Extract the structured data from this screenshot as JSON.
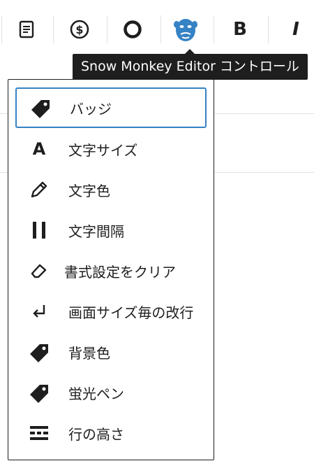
{
  "tooltip": {
    "text": "Snow Monkey Editor コントロール"
  },
  "toolbar": {
    "buttons": [
      {
        "name": "list-icon",
        "label": ""
      },
      {
        "name": "dollar-icon",
        "label": ""
      },
      {
        "name": "circle-icon",
        "label": ""
      },
      {
        "name": "monkey-icon",
        "label": "",
        "color": "#3582c4"
      },
      {
        "name": "bold-button",
        "label": "B"
      },
      {
        "name": "italic-button",
        "label": "I"
      }
    ]
  },
  "menu": {
    "items": [
      {
        "icon": "tag-icon",
        "label": "バッジ",
        "active": true
      },
      {
        "icon": "font-size-icon",
        "label": "文字サイズ",
        "glyph": "A"
      },
      {
        "icon": "pencil-icon",
        "label": "文字色"
      },
      {
        "icon": "letter-spacing-icon",
        "label": "文字間隔"
      },
      {
        "icon": "eraser-icon",
        "label": "書式設定をクリア"
      },
      {
        "icon": "return-arrow-icon",
        "label": "画面サイズ毎の改行"
      },
      {
        "icon": "tag-icon",
        "label": "背景色"
      },
      {
        "icon": "tag-icon",
        "label": "蛍光ペン"
      },
      {
        "icon": "line-height-icon",
        "label": "行の高さ"
      }
    ]
  },
  "colors": {
    "accent": "#3582c4",
    "tooltip_bg": "#1e1e1e",
    "text": "#1e1e1e"
  }
}
